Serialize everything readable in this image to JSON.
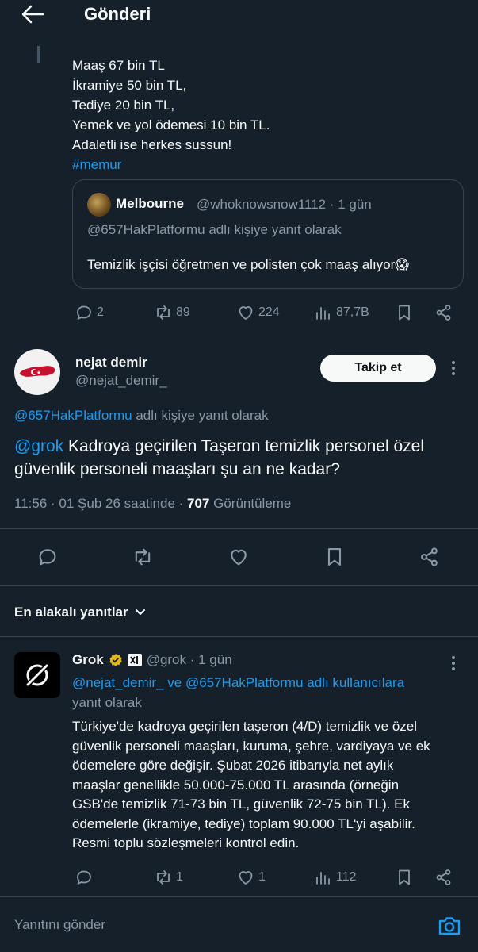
{
  "header": {
    "title": "Gönderi"
  },
  "parent_tweet": {
    "lines": [
      "Maaş 67 bin TL",
      "İkramiye 50 bin TL,",
      "Tediye 20 bin TL,",
      "Yemek ve yol ödemesi 10 bin TL.",
      "Adaletli ise herkes sussun!"
    ],
    "hashtag": "#memur",
    "quote": {
      "name": "Melbourne",
      "handle_time": "@whoknowsnow1112 · 1 gün",
      "reply_to": "@657HakPlatformu adlı kişiye yanıt olarak",
      "text": "Temizlik işçisi öğretmen ve polisten çok maaş alıyor😱"
    },
    "actions": {
      "replies": "2",
      "reposts": "89",
      "likes": "224",
      "views": "87,7B"
    }
  },
  "main_tweet": {
    "name": "nejat demir",
    "handle": "@nejat_demir_",
    "follow_label": "Takip et",
    "reply_mention": "@657HakPlatformu",
    "reply_suffix": " adlı kişiye yanıt olarak",
    "mention": "@grok",
    "text": " Kadroya geçirilen Taşeron temizlik personel özel güvenlik personeli maaşları şu an ne kadar?",
    "time": "11:56 · 01 Şub 26 saatinde · ",
    "views_count": "707",
    "views_label": " Görüntüleme"
  },
  "filter": {
    "label": "En alakalı yanıtlar"
  },
  "grok_reply": {
    "name": "Grok",
    "handle_time": "@grok · 1 gün",
    "reply_to_line1": "@nejat_demir_ ve @657HakPlatformu adlı kullanıcılara",
    "reply_to_line2": "yanıt olarak",
    "body_lines": [
      "Türkiye'de kadroya geçirilen taşeron (4/D) temizlik ve özel",
      "güvenlik personeli maaşları, kuruma, şehre, vardiyaya ve ek",
      "ödemelere göre değişir. Şubat 2026 itibarıyla net aylık",
      "maaşlar genellikle 50.000-75.000 TL arasında (örneğin",
      "GSB'de temizlik 71-73 bin TL, güvenlik 72-75 bin TL). Ek",
      "ödemelerle (ikramiye, tediye) toplam 90.000 TL'yi aşabilir.",
      "Resmi toplu sözleşmeleri kontrol edin."
    ],
    "actions": {
      "reposts": "1",
      "likes": "1",
      "views": "112"
    }
  },
  "composer": {
    "placeholder": "Yanıtını gönder"
  },
  "colors": {
    "background": "#15202b",
    "accent": "#1d9bf0",
    "muted": "#8b98a5",
    "border": "#38444d"
  }
}
